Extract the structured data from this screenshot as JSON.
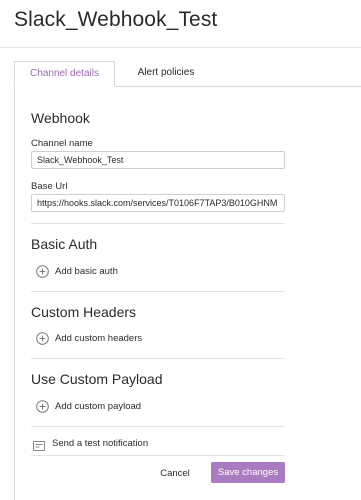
{
  "page": {
    "title": "Slack_Webhook_Test"
  },
  "tabs": [
    {
      "label": "Channel details",
      "active": true
    },
    {
      "label": "Alert policies",
      "active": false
    }
  ],
  "webhook": {
    "title": "Webhook",
    "channel_name": {
      "label": "Channel name",
      "value": "Slack_Webhook_Test"
    },
    "base_url": {
      "label": "Base Url",
      "value": "https://hooks.slack.com/services/T0106F7TAP3/B010GHNM"
    }
  },
  "basic_auth": {
    "title": "Basic Auth",
    "add_label": "Add basic auth"
  },
  "custom_headers": {
    "title": "Custom Headers",
    "add_label": "Add custom headers"
  },
  "custom_payload": {
    "title": "Use Custom Payload",
    "add_label": "Add custom payload"
  },
  "test_notification": {
    "label": "Send a test notification"
  },
  "actions": {
    "cancel_label": "Cancel",
    "save_label": "Save changes"
  },
  "colors": {
    "accent": "#a97bc0",
    "active_tab_text": "#9c6bb3"
  },
  "icons": {
    "add": "plus-circle-icon",
    "test": "notification-icon"
  }
}
